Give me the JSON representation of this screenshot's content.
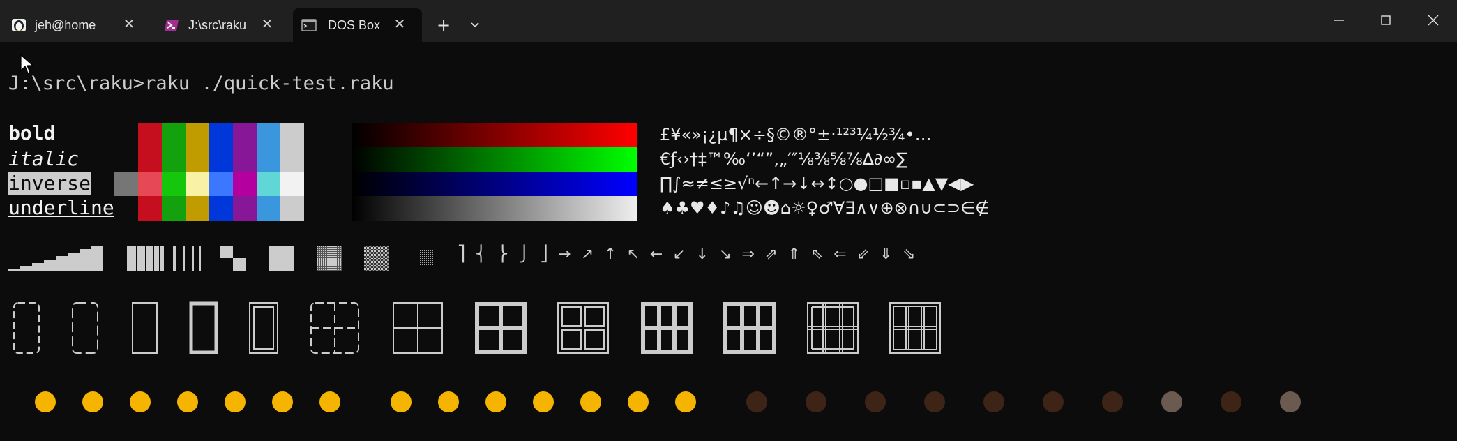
{
  "tabs": [
    {
      "label": "jeh@home",
      "icon": "penguin-icon"
    },
    {
      "label": "J:\\src\\raku",
      "icon": "powershell-icon"
    },
    {
      "label": "DOS Box",
      "icon": "cmd-icon"
    }
  ],
  "window": {
    "new_tab": "+",
    "dropdown": "⌄",
    "minimize": "─",
    "maximize": "☐",
    "close": "✕",
    "tab_close": "✕"
  },
  "terminal": {
    "prompt": "J:\\src\\raku>raku ./quick-test.raku",
    "styles": [
      "bold",
      "italic",
      "inverse",
      "underline"
    ],
    "char_lines": [
      "£¥«»¡¿µ¶×÷§©®°±·¹²³¼½¾•…",
      "€ƒ‹›†‡™‰‘’“”‚„′″⅛⅜⅝⅞∆∂∞∑",
      "∏∫≈≠≤≥√ⁿ←↑→↓↔↕○●□■▫▪▲▼◀▶",
      "♠♣♥♦♪♫☺☻⌂☼♀♂∀∃∧∨⊕⊗∩∪⊂⊃∈∉"
    ],
    "arrows": "⎤⎨⎬⎭⎦→↗↑↖←↙↓↘⇒⇗⇑⇖⇐⇙⇓⇘",
    "colors": {
      "normal": [
        "#c50f1f",
        "#13a10e",
        "#c19c00",
        "#0037da",
        "#881798",
        "#3a96dd",
        "#cccccc"
      ],
      "bright": [
        "#767676",
        "#e74856",
        "#16c60c",
        "#f9f1a5",
        "#3b78ff",
        "#b4009e",
        "#61d6d6",
        "#f2f2f2"
      ]
    }
  }
}
